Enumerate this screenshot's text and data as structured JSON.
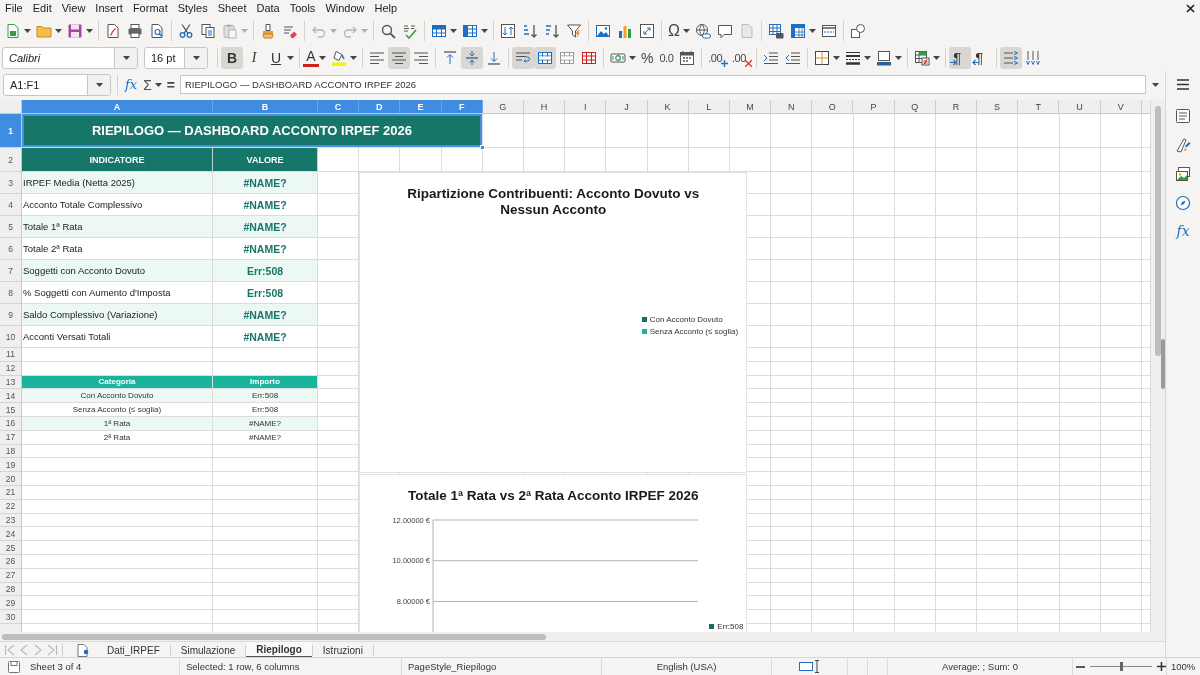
{
  "menu_bar": [
    "File",
    "Edit",
    "View",
    "Insert",
    "Format",
    "Styles",
    "Sheet",
    "Data",
    "Tools",
    "Window",
    "Help"
  ],
  "standard_toolbar": {
    "paste": {
      "disabled": true
    },
    "undo": {
      "disabled": true
    },
    "redo": {
      "disabled": true
    },
    "special_character": "Ω"
  },
  "format_toolbar": {
    "font_name": "Calibri",
    "font_size": "16 pt",
    "text_styles": [
      {
        "kind": "bold",
        "label": "B",
        "on": true
      },
      {
        "kind": "italic",
        "label": "I",
        "on": false
      },
      {
        "kind": "underline",
        "label": "U",
        "on": false
      }
    ],
    "font_color": "A",
    "horizontal_align": [
      {
        "kind": "left",
        "selected": false
      },
      {
        "kind": "center",
        "selected": true
      },
      {
        "kind": "right",
        "selected": false
      }
    ],
    "vertical_align": [
      {
        "kind": "top",
        "selected": false
      },
      {
        "kind": "center",
        "selected": true
      },
      {
        "kind": "bottom",
        "selected": false
      }
    ],
    "wrap_text": {
      "on": true
    },
    "merge_and_center": {
      "on": true
    },
    "percent": "%",
    "standard_number": "0.0",
    "add_decimal": ".00",
    "delete_decimal": ".00",
    "paragraph_direction": [
      {
        "kind": "ltr",
        "label": "¶",
        "selected": true
      },
      {
        "kind": "rtl",
        "label": "¶",
        "selected": false
      }
    ],
    "text_direction": [
      {
        "kind": "horizontal",
        "selected": true
      },
      {
        "kind": "vertical",
        "selected": false
      }
    ]
  },
  "formula_bar": {
    "name_box": "A1:F1",
    "function_wizard": "fx",
    "sum": "Σ",
    "formula": "=",
    "content": "RIEPILOGO — DASHBOARD ACCONTO IRPEF 2026"
  },
  "sheet": {
    "columns": [
      {
        "label": "A",
        "selected": true
      },
      {
        "label": "B",
        "selected": true
      },
      {
        "label": "C",
        "selected": true
      },
      {
        "label": "D",
        "selected": true
      },
      {
        "label": "E",
        "selected": true
      },
      {
        "label": "F",
        "selected": true
      },
      {
        "label": "G",
        "selected": false
      },
      {
        "label": "H",
        "selected": false
      },
      {
        "label": "I",
        "selected": false
      },
      {
        "label": "J",
        "selected": false
      },
      {
        "label": "K",
        "selected": false
      },
      {
        "label": "L",
        "selected": false
      },
      {
        "label": "M",
        "selected": false
      },
      {
        "label": "N",
        "selected": false
      },
      {
        "label": "O",
        "selected": false
      },
      {
        "label": "P",
        "selected": false
      },
      {
        "label": "Q",
        "selected": false
      },
      {
        "label": "R",
        "selected": false
      },
      {
        "label": "S",
        "selected": false
      },
      {
        "label": "T",
        "selected": false
      },
      {
        "label": "U",
        "selected": false
      },
      {
        "label": "V",
        "selected": false
      }
    ],
    "rows": [
      {
        "label": "1",
        "selected": true
      },
      {
        "label": "2",
        "selected": false
      },
      {
        "label": "3",
        "selected": false
      },
      {
        "label": "4",
        "selected": false
      },
      {
        "label": "5",
        "selected": false
      },
      {
        "label": "6",
        "selected": false
      },
      {
        "label": "7",
        "selected": false
      },
      {
        "label": "8",
        "selected": false
      },
      {
        "label": "9",
        "selected": false
      },
      {
        "label": "10",
        "selected": false
      },
      {
        "label": "11",
        "selected": false
      },
      {
        "label": "12",
        "selected": false
      },
      {
        "label": "13",
        "selected": false
      },
      {
        "label": "14",
        "selected": false
      },
      {
        "label": "15",
        "selected": false
      },
      {
        "label": "16",
        "selected": false
      },
      {
        "label": "17",
        "selected": false
      },
      {
        "label": "18",
        "selected": false
      },
      {
        "label": "19",
        "selected": false
      },
      {
        "label": "20",
        "selected": false
      },
      {
        "label": "21",
        "selected": false
      },
      {
        "label": "22",
        "selected": false
      },
      {
        "label": "23",
        "selected": false
      },
      {
        "label": "24",
        "selected": false
      },
      {
        "label": "25",
        "selected": false
      },
      {
        "label": "26",
        "selected": false
      },
      {
        "label": "27",
        "selected": false
      },
      {
        "label": "28",
        "selected": false
      },
      {
        "label": "29",
        "selected": false
      },
      {
        "label": "30",
        "selected": false
      }
    ],
    "title_cell": {
      "text": "RIEPILOGO — DASHBOARD ACCONTO IRPEF 2026",
      "selected": true
    },
    "indicator_table": {
      "columns": [
        "INDICATORE",
        "VALORE"
      ],
      "rows": [
        {
          "indicator": "IRPEF Media (Netta 2025)",
          "value": "#NAME?"
        },
        {
          "indicator": "Acconto Totale Complessivo",
          "value": "#NAME?"
        },
        {
          "indicator": "Totale 1ª Rata",
          "value": "#NAME?"
        },
        {
          "indicator": "Totale 2ª Rata",
          "value": "#NAME?"
        },
        {
          "indicator": "Soggetti con Acconto Dovuto",
          "value": "Err:508"
        },
        {
          "indicator": "% Soggetti con Aumento d'Imposta",
          "value": "Err:508"
        },
        {
          "indicator": "Saldo Complessivo (Variazione)",
          "value": "#NAME?"
        },
        {
          "indicator": "Acconti Versati Totali",
          "value": "#NAME?"
        }
      ]
    },
    "category_table": {
      "columns": [
        "Categoria",
        "Importo"
      ],
      "rows": [
        {
          "category": "Con Acconto Dovuto",
          "amount": "Err:508"
        },
        {
          "category": "Senza Acconto (≤ soglia)",
          "amount": "Err:508"
        },
        {
          "category": "1ª Rata",
          "amount": "#NAME?"
        },
        {
          "category": "2ª Rata",
          "amount": "#NAME?"
        }
      ]
    },
    "charts": [
      {
        "chart_data": {
          "type": "pie",
          "title": "Ripartizione Contribuenti: Acconto Dovuto vs Nessun Acconto"
        },
        "legend": [
          {
            "label": "Con Acconto Dovuto",
            "color": "#1a6b5f"
          },
          {
            "label": "Senza Acconto (≤ soglia)",
            "color": "#21b09a"
          }
        ]
      },
      {
        "chart_data": {
          "type": "bar",
          "title": "Totale 1ª Rata vs 2ª Rata Acconto IRPEF 2026",
          "ylim": [
            6.5,
            12
          ],
          "yticks": [
            {
              "value": 8,
              "label": "8.00000 €"
            },
            {
              "value": 10,
              "label": "10.00000 €"
            },
            {
              "value": 12,
              "label": "12.00000 €"
            }
          ],
          "series": [
            {
              "name": "Err:508",
              "color": "#1a6b5f"
            }
          ]
        }
      }
    ]
  },
  "sheet_tabs": [
    {
      "label": "Dati_IRPEF",
      "selected": false
    },
    {
      "label": "Simulazione",
      "selected": false
    },
    {
      "label": "Riepilogo",
      "selected": true
    },
    {
      "label": "Istruzioni",
      "selected": false
    }
  ],
  "status_bar": {
    "sheet_position": "Sheet 3 of 4",
    "selection": "Selected: 1 row, 6 columns",
    "page_style": "PageStyle_Riepilogo",
    "language": "English (USA)",
    "summary": "Average: ; Sum: 0",
    "zoom_slider": {
      "level": 0.5
    },
    "zoom": "100%"
  },
  "sidebar": {
    "functions": "fx"
  }
}
